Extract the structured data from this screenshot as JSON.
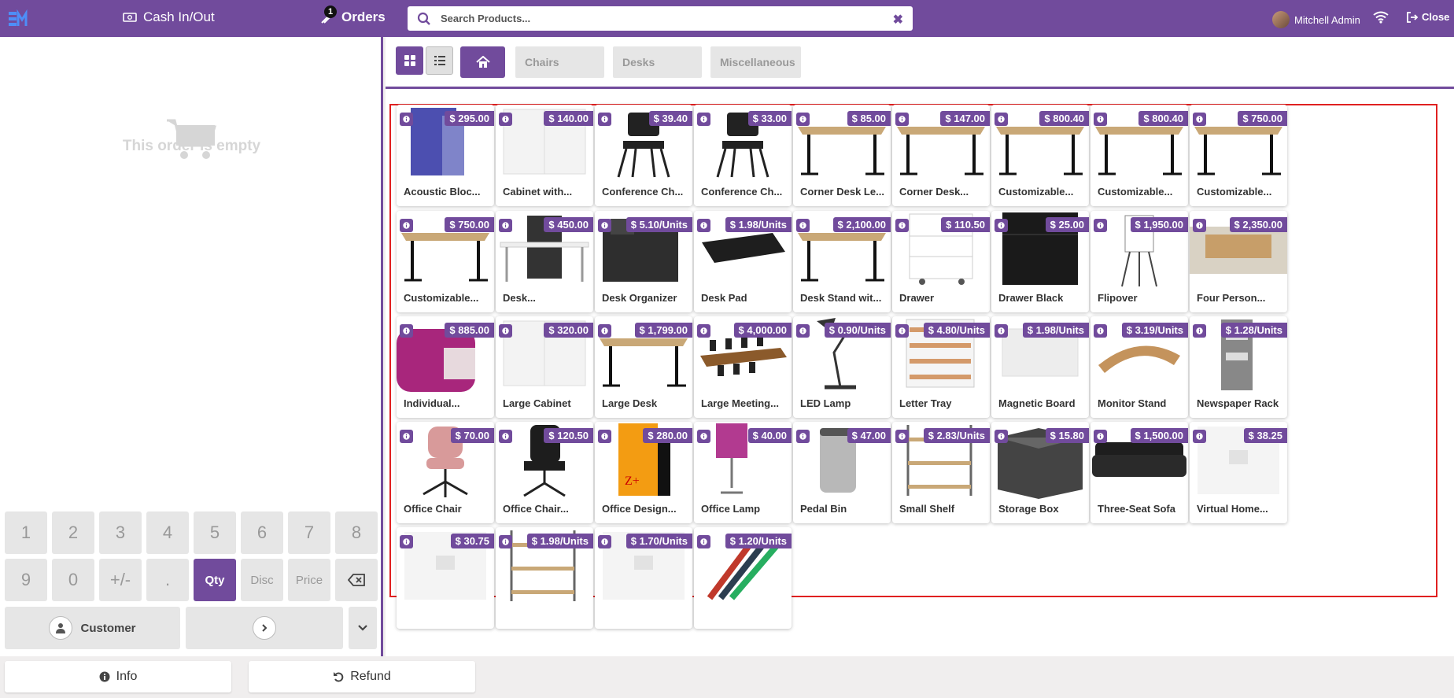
{
  "header": {
    "cash_label": "Cash In/Out",
    "orders_label": "Orders",
    "orders_count": "1",
    "search_placeholder": "Search Products...",
    "user_name": "Mitchell Admin",
    "close_label": "Close"
  },
  "order": {
    "empty_text": "This order is empty"
  },
  "numpad": {
    "keys": [
      "1",
      "2",
      "3",
      "4",
      "5",
      "6",
      "7",
      "8",
      "9",
      "0",
      "+/-",
      ".",
      "Qty",
      "Disc",
      "Price"
    ],
    "customer_label": "Customer"
  },
  "categories": [
    "Chairs",
    "Desks",
    "Miscellaneous"
  ],
  "products": [
    {
      "name": "Acoustic Bloc...",
      "price": "$ 295.00",
      "icon": "acoustic-screen"
    },
    {
      "name": "Cabinet with...",
      "price": "$ 140.00",
      "icon": "cabinet"
    },
    {
      "name": "Conference Ch...",
      "price": "$ 39.40",
      "icon": "chair"
    },
    {
      "name": "Conference Ch...",
      "price": "$ 33.00",
      "icon": "chair"
    },
    {
      "name": "Corner Desk Le...",
      "price": "$ 85.00",
      "icon": "desk"
    },
    {
      "name": "Corner Desk...",
      "price": "$ 147.00",
      "icon": "desk"
    },
    {
      "name": "Customizable...",
      "price": "$ 800.40",
      "icon": "desk"
    },
    {
      "name": "Customizable...",
      "price": "$ 800.40",
      "icon": "desk"
    },
    {
      "name": "Customizable...",
      "price": "$ 750.00",
      "icon": "desk"
    },
    {
      "name": "Customizable...",
      "price": "$ 750.00",
      "icon": "desk"
    },
    {
      "name": "Desk...",
      "price": "$ 450.00",
      "icon": "desk-combo"
    },
    {
      "name": "Desk Organizer",
      "price": "$ 5.10/Units",
      "icon": "organizer"
    },
    {
      "name": "Desk Pad",
      "price": "$ 1.98/Units",
      "icon": "desk-pad"
    },
    {
      "name": "Desk Stand wit...",
      "price": "$ 2,100.00",
      "icon": "desk"
    },
    {
      "name": "Drawer",
      "price": "$ 110.50",
      "icon": "drawer-white"
    },
    {
      "name": "Drawer Black",
      "price": "$ 25.00",
      "icon": "drawer-black"
    },
    {
      "name": "Flipover",
      "price": "$ 1,950.00",
      "icon": "flipchart"
    },
    {
      "name": "Four Person...",
      "price": "$ 2,350.00",
      "icon": "workstation"
    },
    {
      "name": "Individual...",
      "price": "$ 885.00",
      "icon": "pod"
    },
    {
      "name": "Large Cabinet",
      "price": "$ 320.00",
      "icon": "cabinet"
    },
    {
      "name": "Large Desk",
      "price": "$ 1,799.00",
      "icon": "desk"
    },
    {
      "name": "Large Meeting...",
      "price": "$ 4,000.00",
      "icon": "meeting-table"
    },
    {
      "name": "LED Lamp",
      "price": "$ 0.90/Units",
      "icon": "lamp"
    },
    {
      "name": "Letter Tray",
      "price": "$ 4.80/Units",
      "icon": "tray"
    },
    {
      "name": "Magnetic Board",
      "price": "$ 1.98/Units",
      "icon": "board"
    },
    {
      "name": "Monitor Stand",
      "price": "$ 3.19/Units",
      "icon": "monitor-stand"
    },
    {
      "name": "Newspaper Rack",
      "price": "$ 1.28/Units",
      "icon": "rack"
    },
    {
      "name": "Office Chair",
      "price": "$ 70.00",
      "icon": "pink-chair"
    },
    {
      "name": "Office Chair...",
      "price": "$ 120.50",
      "icon": "black-chair"
    },
    {
      "name": "Office Design...",
      "price": "$ 280.00",
      "icon": "software-box"
    },
    {
      "name": "Office Lamp",
      "price": "$ 40.00",
      "icon": "table-lamp"
    },
    {
      "name": "Pedal Bin",
      "price": "$ 47.00",
      "icon": "bin"
    },
    {
      "name": "Small Shelf",
      "price": "$ 2.83/Units",
      "icon": "shelf"
    },
    {
      "name": "Storage Box",
      "price": "$ 15.80",
      "icon": "storage-box"
    },
    {
      "name": "Three-Seat Sofa",
      "price": "$ 1,500.00",
      "icon": "sofa"
    },
    {
      "name": "Virtual Home...",
      "price": "$ 38.25",
      "icon": "placeholder"
    },
    {
      "name": "",
      "price": "$ 30.75",
      "icon": "placeholder"
    },
    {
      "name": "",
      "price": "$ 1.98/Units",
      "icon": "shelf"
    },
    {
      "name": "",
      "price": "$ 1.70/Units",
      "icon": "placeholder"
    },
    {
      "name": "",
      "price": "$ 1.20/Units",
      "icon": "markers"
    }
  ],
  "bottom": {
    "info_label": "Info",
    "refund_label": "Refund"
  },
  "colors": {
    "brand": "#714B9C",
    "highlight": "#e02020"
  }
}
